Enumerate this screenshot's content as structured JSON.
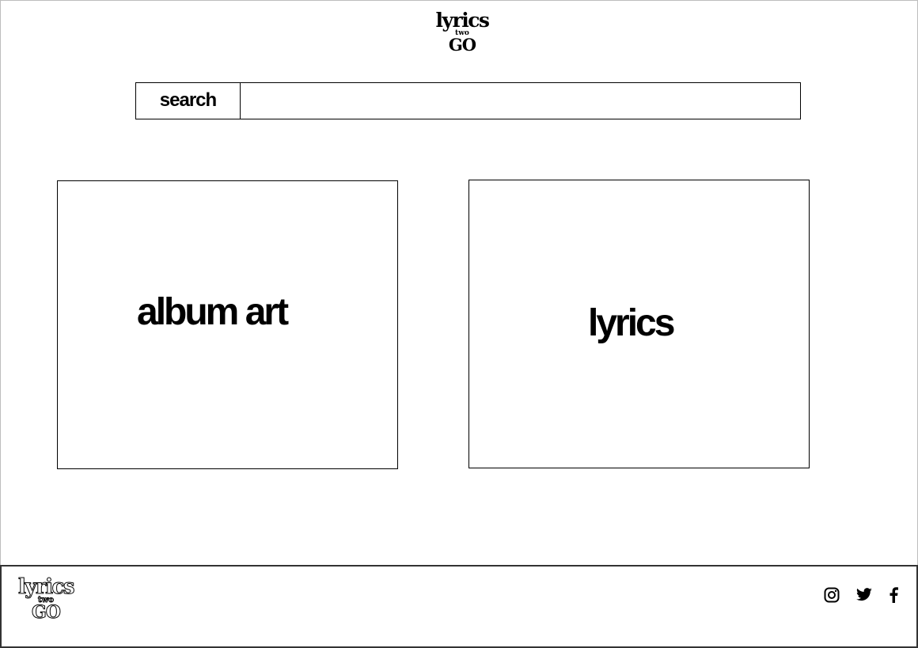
{
  "header": {
    "logo": {
      "line1": "lyrics",
      "line2": "two",
      "line3": "GO"
    }
  },
  "search": {
    "button_label": "search",
    "input_value": "",
    "placeholder": ""
  },
  "panels": {
    "album_art": {
      "label": "album art"
    },
    "lyrics": {
      "label": "lyrics"
    }
  },
  "footer": {
    "logo": {
      "line1": "lyrics",
      "line2": "two",
      "line3": "GO"
    },
    "social": [
      {
        "icon": "instagram-icon"
      },
      {
        "icon": "twitter-icon"
      },
      {
        "icon": "facebook-icon"
      }
    ]
  },
  "colors": {
    "foreground": "#000000",
    "background": "#ffffff",
    "frame_border": "#bdbdbd"
  }
}
